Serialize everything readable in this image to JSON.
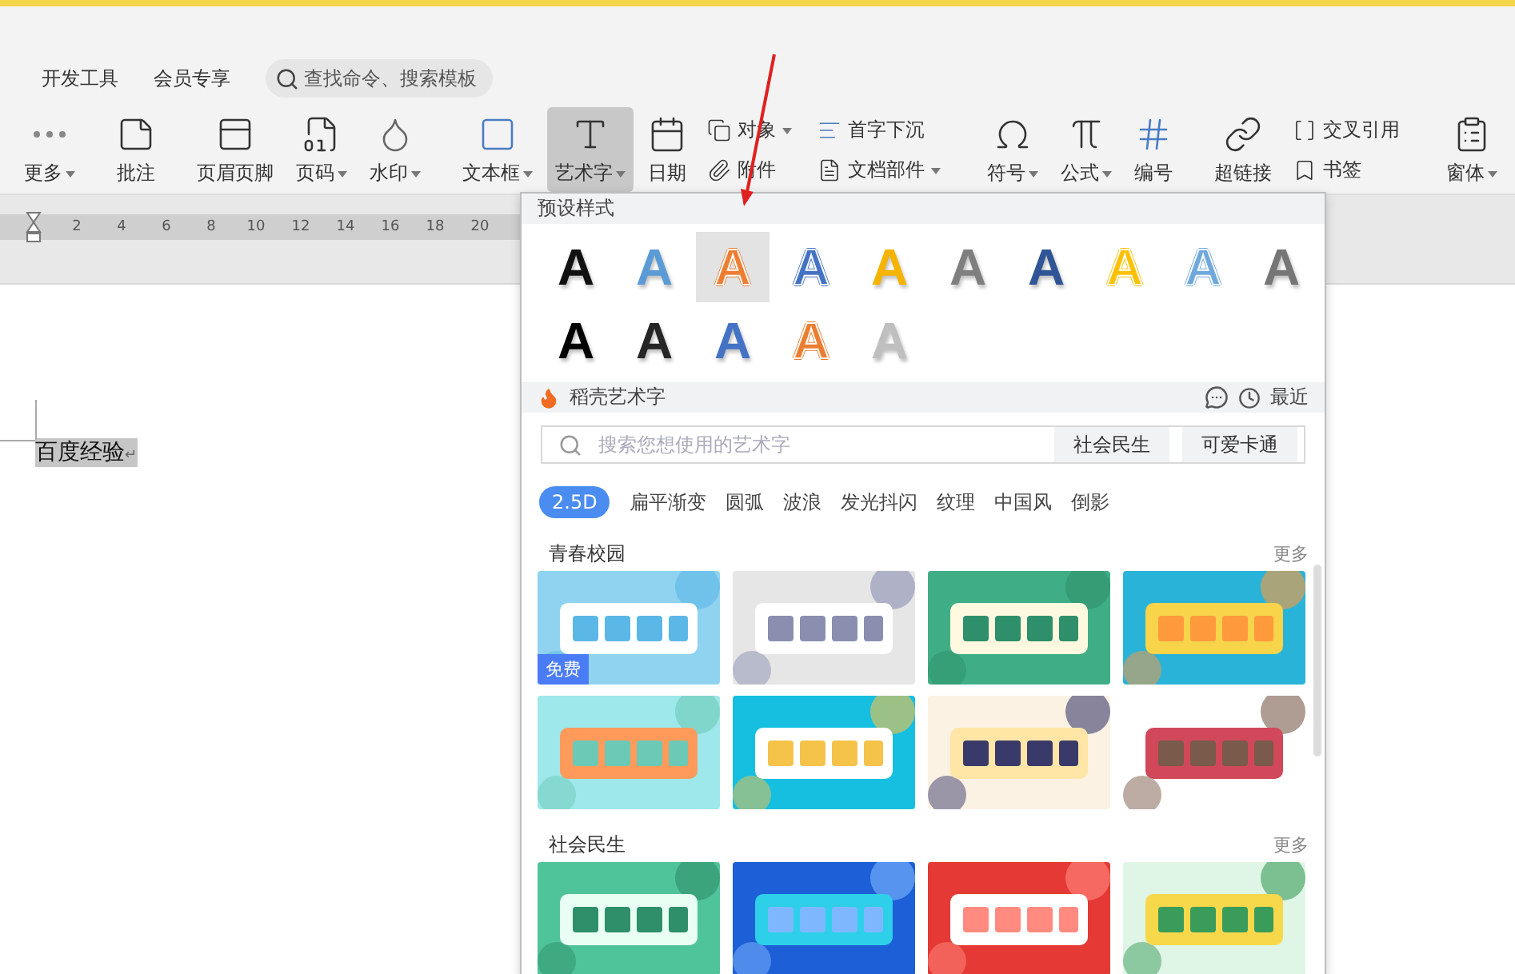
{
  "menu_tabs": [
    {
      "label": "开发工具"
    },
    {
      "label": "会员专享"
    }
  ],
  "command_search": {
    "placeholder": "查找命令、搜索模板"
  },
  "ribbon_groups": [
    {
      "items": [
        {
          "kind": "large",
          "label": "更多",
          "dropdown": true,
          "selected": false
        }
      ]
    },
    {
      "items": [
        {
          "kind": "large",
          "label": "批注",
          "dropdown": false,
          "selected": false
        }
      ]
    },
    {
      "items": [
        {
          "kind": "large",
          "label": "页眉页脚",
          "dropdown": false,
          "selected": false
        },
        {
          "kind": "large",
          "label": "页码",
          "dropdown": true,
          "selected": false
        },
        {
          "kind": "large",
          "label": "水印",
          "dropdown": true,
          "selected": false
        }
      ]
    },
    {
      "items": [
        {
          "kind": "large",
          "label": "文本框",
          "dropdown": true,
          "selected": false
        },
        {
          "kind": "large",
          "label": "艺术字",
          "dropdown": true,
          "selected": true
        },
        {
          "kind": "large",
          "label": "日期",
          "dropdown": false,
          "selected": false
        },
        {
          "kind": "stack",
          "items": [
            {
              "label": "对象",
              "dropdown": true
            },
            {
              "label": "附件",
              "dropdown": false
            }
          ]
        },
        {
          "kind": "stack",
          "items": [
            {
              "label": "首字下沉",
              "dropdown": false
            },
            {
              "label": "文档部件",
              "dropdown": true
            }
          ]
        }
      ]
    },
    {
      "items": [
        {
          "kind": "large",
          "label": "符号",
          "dropdown": true,
          "selected": false
        },
        {
          "kind": "large",
          "label": "公式",
          "dropdown": true,
          "selected": false
        },
        {
          "kind": "large",
          "label": "编号",
          "dropdown": false,
          "selected": false
        }
      ]
    },
    {
      "items": [
        {
          "kind": "large",
          "label": "超链接",
          "dropdown": false,
          "selected": false
        },
        {
          "kind": "stack",
          "items": [
            {
              "label": "交叉引用",
              "dropdown": false
            },
            {
              "label": "书签",
              "dropdown": false
            }
          ]
        }
      ]
    },
    {
      "items": [
        {
          "kind": "large",
          "label": "窗体",
          "dropdown": true,
          "selected": false
        }
      ]
    }
  ],
  "ruler": {
    "ticks": [
      "2",
      "4",
      "6",
      "8",
      "10",
      "12",
      "14",
      "16",
      "18",
      "20"
    ]
  },
  "document": {
    "text": "百度经验",
    "mark": "↵",
    "selected": true
  },
  "wordart_panel": {
    "preset_title": "预设样式",
    "presets": [
      {
        "text": "A",
        "color": "#111111",
        "outline": false,
        "selected": false
      },
      {
        "text": "A",
        "color": "#5b9bd5",
        "outline": false,
        "selected": false
      },
      {
        "text": "A",
        "color": "#ed7d31",
        "outline": true,
        "selected": true
      },
      {
        "text": "A",
        "color": "#4472c4",
        "outline": true,
        "selected": false
      },
      {
        "text": "A",
        "color": "#f5b400",
        "outline": false,
        "selected": false
      },
      {
        "text": "A",
        "color": "#7f7f7f",
        "outline": false,
        "selected": false
      },
      {
        "text": "A",
        "color": "#2f5597",
        "outline": false,
        "selected": false
      },
      {
        "text": "A",
        "color": "#ffc000",
        "outline": true,
        "selected": false
      },
      {
        "text": "A",
        "color": "#6fa8dc",
        "outline": true,
        "selected": false
      },
      {
        "text": "A",
        "color": "#767676",
        "outline": false,
        "selected": false
      },
      {
        "text": "A",
        "color": "#000000",
        "outline": false,
        "selected": false
      },
      {
        "text": "A",
        "color": "#262626",
        "outline": false,
        "selected": false
      },
      {
        "text": "A",
        "color": "#4472c4",
        "outline": false,
        "selected": false
      },
      {
        "text": "A",
        "color": "#ed7d31",
        "outline": true,
        "selected": false
      },
      {
        "text": "A",
        "color": "#bfbfbf",
        "outline": false,
        "selected": false
      }
    ],
    "docer_title": "稻壳艺术字",
    "recent": "最近",
    "search": {
      "placeholder": "搜索您想使用的艺术字"
    },
    "quick_tags": [
      "社会民生",
      "可爱卡通"
    ],
    "categories": [
      {
        "label": "2.5D",
        "selected": true
      },
      {
        "label": "扁平渐变",
        "selected": false
      },
      {
        "label": "圆弧",
        "selected": false
      },
      {
        "label": "波浪",
        "selected": false
      },
      {
        "label": "发光抖闪",
        "selected": false
      },
      {
        "label": "纹理",
        "selected": false
      },
      {
        "label": "中国风",
        "selected": false
      },
      {
        "label": "倒影",
        "selected": false
      }
    ],
    "sections": [
      {
        "title": "青春校园",
        "more": "更多",
        "templates": [
          {
            "kind": "picture",
            "badge": "免费"
          },
          {
            "kind": "picture"
          },
          {
            "kind": "picture"
          },
          {
            "kind": "picture"
          },
          {
            "kind": "picture"
          },
          {
            "kind": "picture"
          },
          {
            "kind": "picture"
          },
          {
            "kind": "picture"
          }
        ]
      },
      {
        "title": "社会民生",
        "more": "更多",
        "templates": [
          {
            "kind": "picture"
          },
          {
            "kind": "picture"
          },
          {
            "kind": "picture"
          },
          {
            "kind": "picture"
          }
        ]
      }
    ]
  }
}
